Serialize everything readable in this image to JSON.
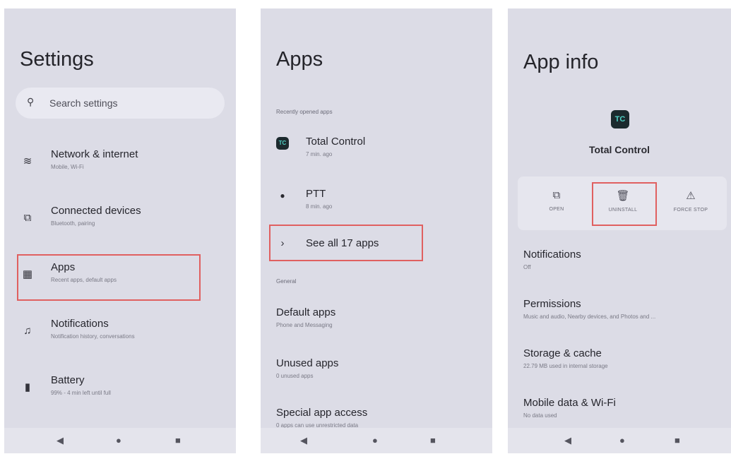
{
  "screen1": {
    "title": "Settings",
    "search": {
      "icon": "search-icon",
      "placeholder": "Search settings"
    },
    "items": [
      {
        "icon": "wifi-icon",
        "glyph": "≋",
        "label": "Network & internet",
        "sub": "Mobile, Wi-Fi"
      },
      {
        "icon": "devices-icon",
        "glyph": "⧉",
        "label": "Connected devices",
        "sub": "Bluetooth, pairing"
      },
      {
        "icon": "apps-grid-icon",
        "glyph": "▦",
        "label": "Apps",
        "sub": "Recent apps, default apps"
      },
      {
        "icon": "bell-icon",
        "glyph": "♫",
        "label": "Notifications",
        "sub": "Notification history, conversations"
      },
      {
        "icon": "battery-icon",
        "glyph": "▮",
        "label": "Battery",
        "sub": "99% - 4 min left until full"
      }
    ],
    "nav": [
      "◀",
      "●",
      "■"
    ]
  },
  "screen2": {
    "title": "Apps",
    "recent_header": "Recently opened apps",
    "recent": [
      {
        "icon": "total-control-icon",
        "glyph": "TC",
        "label": "Total Control",
        "sub": "7 min. ago"
      },
      {
        "icon": "ptt-icon",
        "glyph": "●",
        "label": "PTT",
        "sub": "8 min. ago"
      }
    ],
    "see_all": {
      "chevron": "›",
      "label": "See all 17 apps"
    },
    "general_header": "General",
    "general": [
      {
        "label": "Default apps",
        "sub": "Phone and Messaging"
      },
      {
        "label": "Unused apps",
        "sub": "0 unused apps"
      },
      {
        "label": "Special app access",
        "sub": "0 apps can use unrestricted data"
      }
    ],
    "nav": [
      "◀",
      "●",
      "■"
    ]
  },
  "screen3": {
    "title": "App info",
    "app_glyph": "TC",
    "app_name": "Total Control",
    "actions": [
      {
        "icon": "open-icon",
        "glyph": "⧉",
        "label": "OPEN"
      },
      {
        "icon": "trash-icon",
        "glyph": "🗑",
        "label": "UNINSTALL"
      },
      {
        "icon": "warning-icon",
        "glyph": "⚠",
        "label": "FORCE STOP"
      }
    ],
    "items": [
      {
        "label": "Notifications",
        "sub": "Off"
      },
      {
        "label": "Permissions",
        "sub": "Music and audio, Nearby devices, and Photos and ..."
      },
      {
        "label": "Storage & cache",
        "sub": "22.79 MB used in internal storage"
      },
      {
        "label": "Mobile data & Wi-Fi",
        "sub": "No data used"
      }
    ],
    "nav": [
      "◀",
      "●",
      "■"
    ]
  },
  "colors": {
    "highlight": "#e06060",
    "screen_bg": "#dcdce6",
    "accent": "#4fd1c5"
  }
}
